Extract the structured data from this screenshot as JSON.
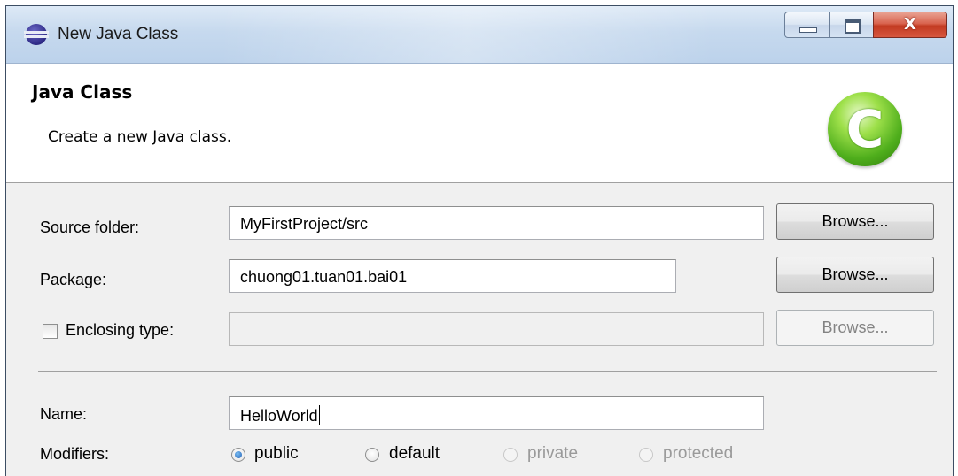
{
  "window": {
    "title": "New Java Class",
    "close_glyph": "X"
  },
  "header": {
    "title": "Java Class",
    "description": "Create a new Java class.",
    "icon_letter": "C"
  },
  "form": {
    "source_folder": {
      "label": "Source folder:",
      "value": "MyFirstProject/src",
      "browse_label": "Browse..."
    },
    "package": {
      "label": "Package:",
      "value": "chuong01.tuan01.bai01",
      "browse_label": "Browse..."
    },
    "enclosing_type": {
      "label": "Enclosing type:",
      "value": "",
      "checked": false,
      "browse_label": "Browse..."
    },
    "name": {
      "label": "Name:",
      "value": "HelloWorld"
    },
    "modifiers": {
      "label": "Modifiers:",
      "options": [
        {
          "label": "public",
          "selected": true,
          "enabled": true
        },
        {
          "label": "default",
          "selected": false,
          "enabled": true
        },
        {
          "label": "private",
          "selected": false,
          "enabled": false
        },
        {
          "label": "protected",
          "selected": false,
          "enabled": false
        }
      ]
    }
  }
}
